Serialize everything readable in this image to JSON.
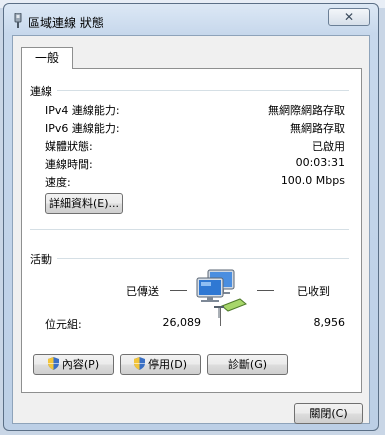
{
  "window": {
    "title": "區域連線 狀態",
    "close_glyph": "✕",
    "tab_label": "一般"
  },
  "connection": {
    "section_label": "連線",
    "rows": [
      {
        "label": "IPv4 連線能力:",
        "value": "無網際網路存取"
      },
      {
        "label": "IPv6 連線能力:",
        "value": "無網路存取"
      },
      {
        "label": "媒體狀態:",
        "value": "已啟用"
      },
      {
        "label": "連線時間:",
        "value": "00:03:31"
      },
      {
        "label": "速度:",
        "value": "100.0 Mbps"
      }
    ],
    "details_button": "詳細資料(E)..."
  },
  "activity": {
    "section_label": "活動",
    "sent_label": "已傳送",
    "received_label": "已收到",
    "bytes_label": "位元組:",
    "bytes_sent": "26,089",
    "bytes_received": "8,956"
  },
  "buttons": {
    "properties": "內容(P)",
    "disable": "停用(D)",
    "diagnose": "診斷(G)",
    "close": "關閉(C)"
  },
  "icons": {
    "title": "network-adapter-icon",
    "shield": "uac-shield-icon",
    "network": "network-computers-icon"
  }
}
